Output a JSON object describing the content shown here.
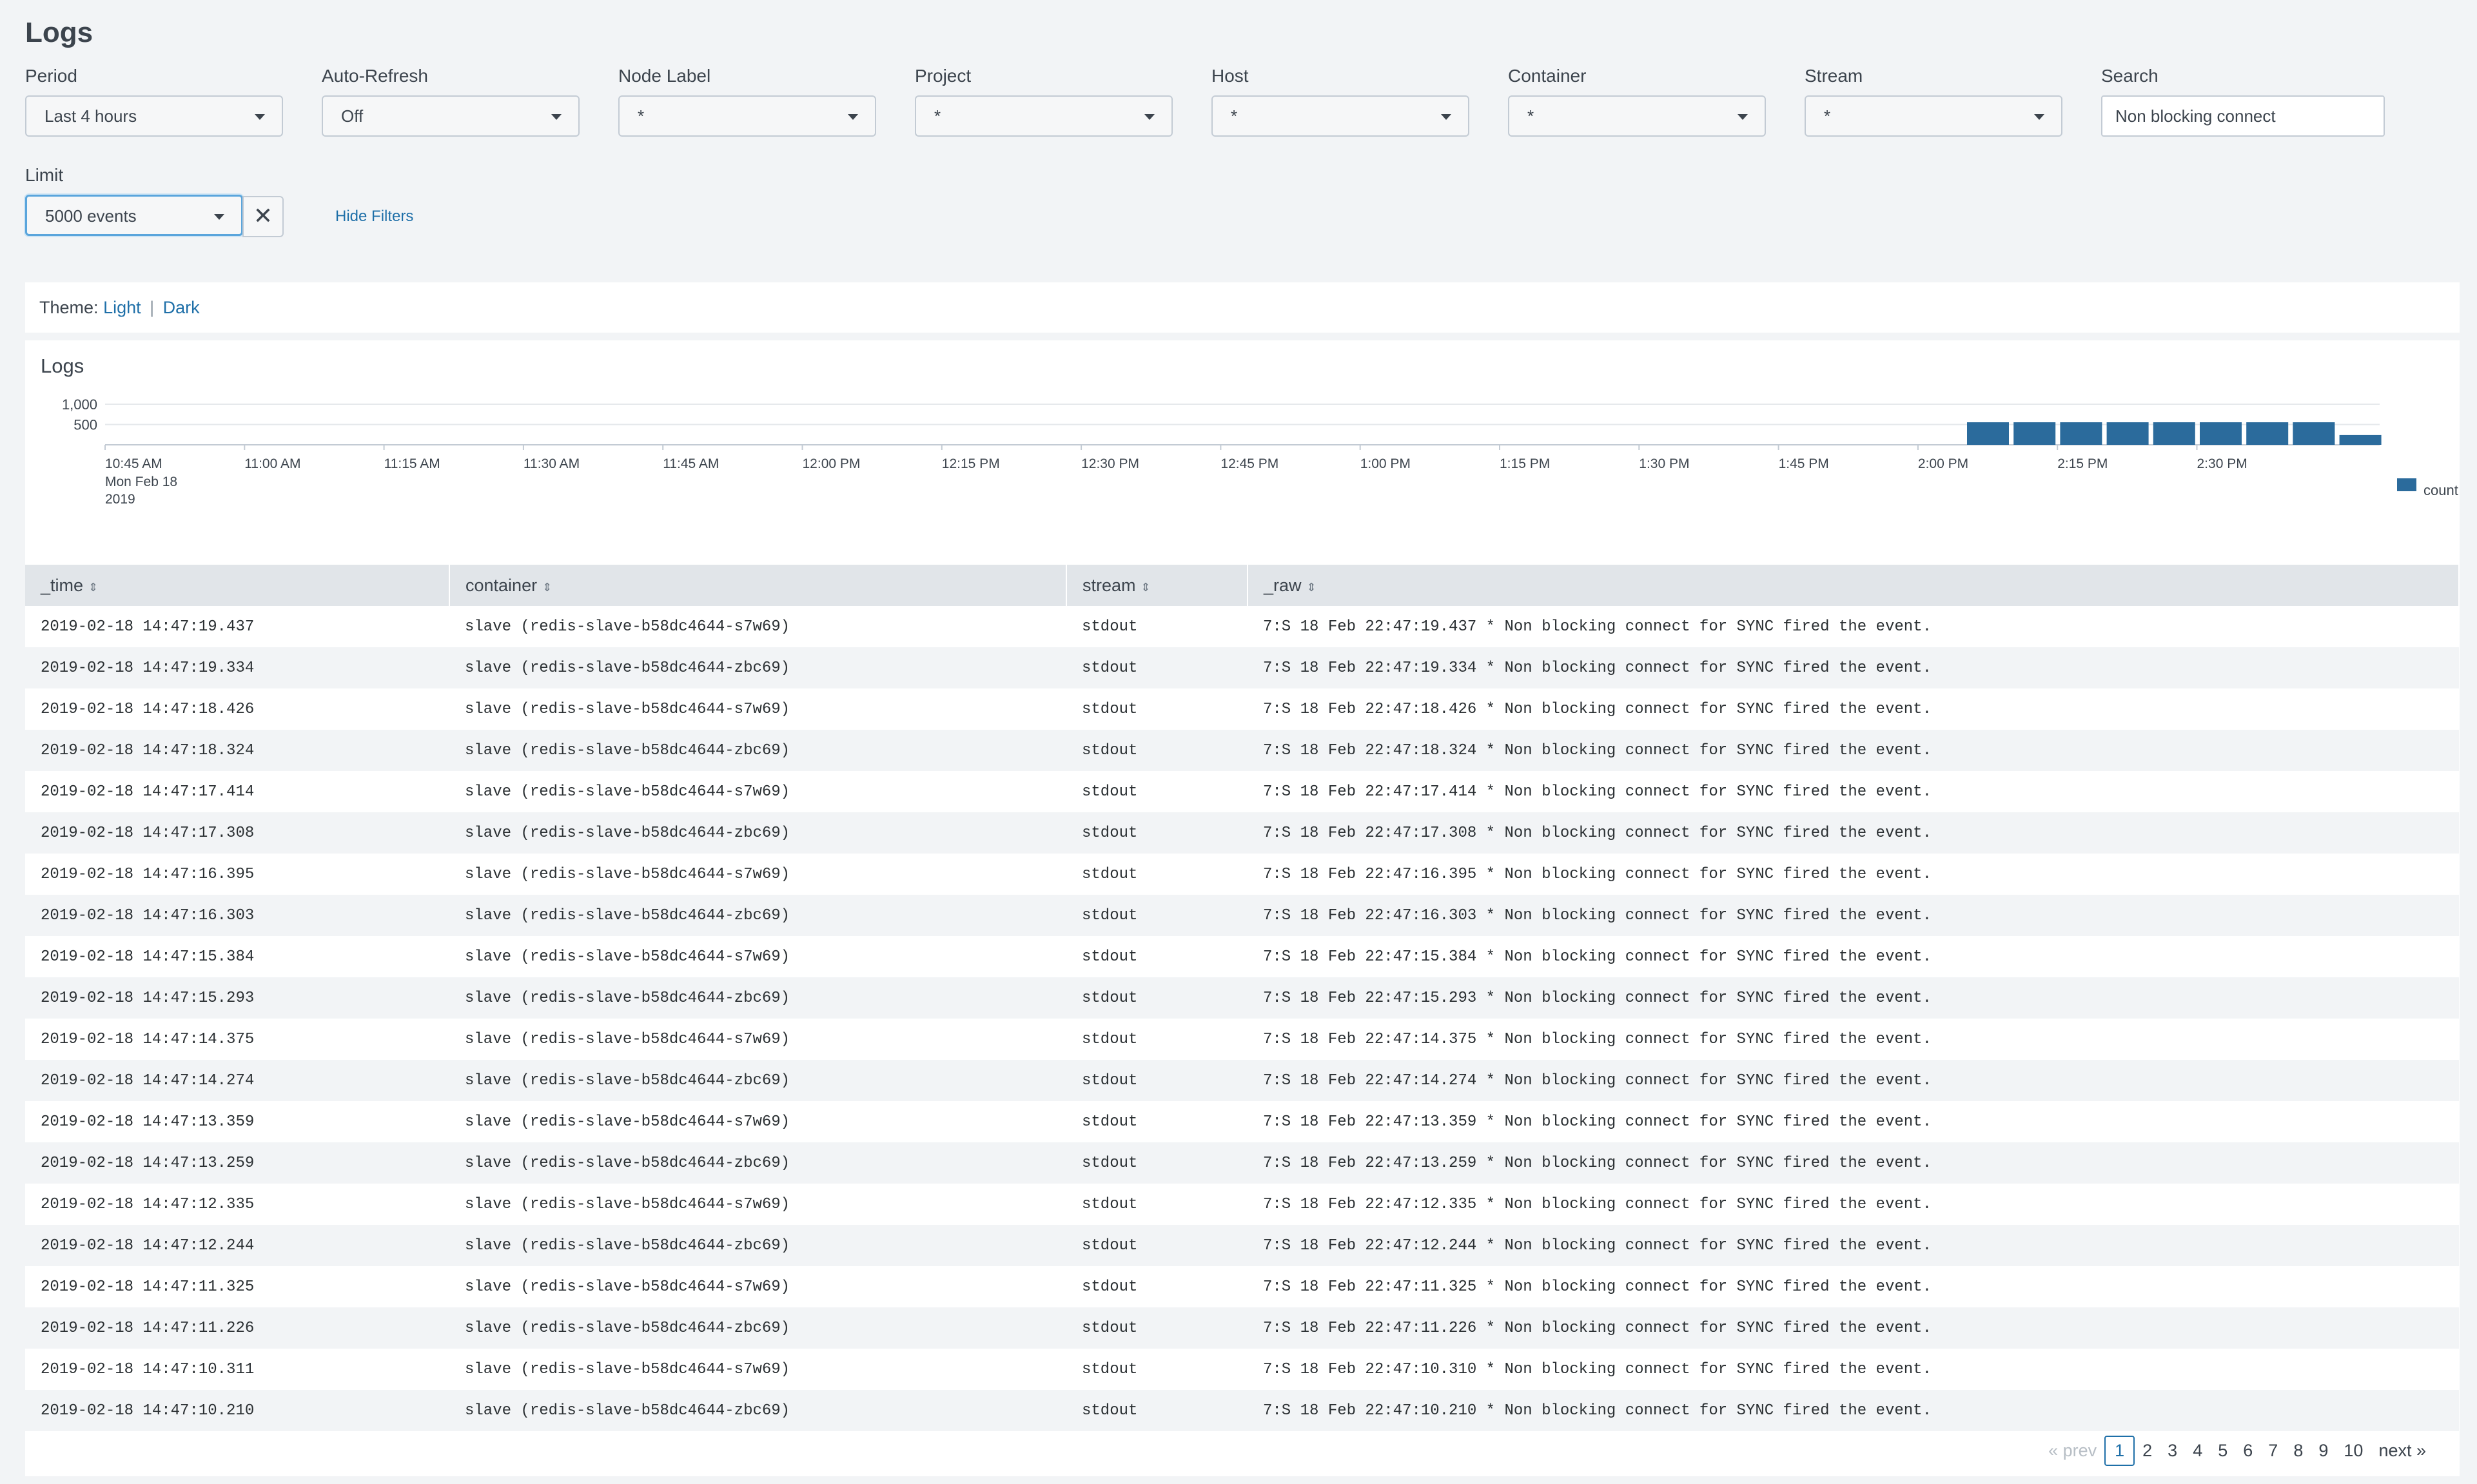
{
  "page": {
    "title": "Logs"
  },
  "filters": {
    "period": {
      "label": "Period",
      "value": "Last 4 hours"
    },
    "auto_refresh": {
      "label": "Auto-Refresh",
      "value": "Off"
    },
    "node_label": {
      "label": "Node Label",
      "value": "*"
    },
    "project": {
      "label": "Project",
      "value": "*"
    },
    "host": {
      "label": "Host",
      "value": "*"
    },
    "container": {
      "label": "Container",
      "value": "*"
    },
    "stream": {
      "label": "Stream",
      "value": "*"
    },
    "search": {
      "label": "Search",
      "value": "Non blocking connect"
    },
    "limit": {
      "label": "Limit",
      "value": "5000 events"
    },
    "clear_glyph": "✕",
    "hide_filters": "Hide Filters"
  },
  "theme": {
    "label": "Theme:",
    "light": "Light",
    "separator": "|",
    "dark": "Dark"
  },
  "logs_panel": {
    "title": "Logs"
  },
  "chart_data": {
    "type": "bar",
    "title": "",
    "xlabel": "",
    "ylabel": "",
    "y_ticks": [
      "1,000",
      "500"
    ],
    "ylim": [
      0,
      1000
    ],
    "x_ticks": [
      "10:45 AM",
      "11:00 AM",
      "11:15 AM",
      "11:30 AM",
      "11:45 AM",
      "12:00 PM",
      "12:15 PM",
      "12:30 PM",
      "12:45 PM",
      "1:00 PM",
      "1:15 PM",
      "1:30 PM",
      "1:45 PM",
      "2:00 PM",
      "2:15 PM",
      "2:30 PM"
    ],
    "x_first_sub": [
      "Mon Feb 18",
      "2019"
    ],
    "categories": [
      "2:05 PM",
      "2:10 PM",
      "2:15 PM",
      "2:20 PM",
      "2:25 PM",
      "2:30 PM",
      "2:35 PM",
      "2:40 PM",
      "2:45 PM"
    ],
    "series": [
      {
        "name": "count",
        "values": [
          555,
          555,
          555,
          555,
          555,
          555,
          555,
          555,
          240
        ],
        "color": "#2b6b9c"
      }
    ],
    "legend_position": "right"
  },
  "table": {
    "columns": [
      "_time",
      "container",
      "stream",
      "_raw"
    ],
    "rows": [
      [
        "2019-02-18 14:47:19.437",
        "slave (redis-slave-b58dc4644-s7w69)",
        "stdout",
        "7:S 18 Feb 22:47:19.437 * Non blocking connect for SYNC fired the event."
      ],
      [
        "2019-02-18 14:47:19.334",
        "slave (redis-slave-b58dc4644-zbc69)",
        "stdout",
        "7:S 18 Feb 22:47:19.334 * Non blocking connect for SYNC fired the event."
      ],
      [
        "2019-02-18 14:47:18.426",
        "slave (redis-slave-b58dc4644-s7w69)",
        "stdout",
        "7:S 18 Feb 22:47:18.426 * Non blocking connect for SYNC fired the event."
      ],
      [
        "2019-02-18 14:47:18.324",
        "slave (redis-slave-b58dc4644-zbc69)",
        "stdout",
        "7:S 18 Feb 22:47:18.324 * Non blocking connect for SYNC fired the event."
      ],
      [
        "2019-02-18 14:47:17.414",
        "slave (redis-slave-b58dc4644-s7w69)",
        "stdout",
        "7:S 18 Feb 22:47:17.414 * Non blocking connect for SYNC fired the event."
      ],
      [
        "2019-02-18 14:47:17.308",
        "slave (redis-slave-b58dc4644-zbc69)",
        "stdout",
        "7:S 18 Feb 22:47:17.308 * Non blocking connect for SYNC fired the event."
      ],
      [
        "2019-02-18 14:47:16.395",
        "slave (redis-slave-b58dc4644-s7w69)",
        "stdout",
        "7:S 18 Feb 22:47:16.395 * Non blocking connect for SYNC fired the event."
      ],
      [
        "2019-02-18 14:47:16.303",
        "slave (redis-slave-b58dc4644-zbc69)",
        "stdout",
        "7:S 18 Feb 22:47:16.303 * Non blocking connect for SYNC fired the event."
      ],
      [
        "2019-02-18 14:47:15.384",
        "slave (redis-slave-b58dc4644-s7w69)",
        "stdout",
        "7:S 18 Feb 22:47:15.384 * Non blocking connect for SYNC fired the event."
      ],
      [
        "2019-02-18 14:47:15.293",
        "slave (redis-slave-b58dc4644-zbc69)",
        "stdout",
        "7:S 18 Feb 22:47:15.293 * Non blocking connect for SYNC fired the event."
      ],
      [
        "2019-02-18 14:47:14.375",
        "slave (redis-slave-b58dc4644-s7w69)",
        "stdout",
        "7:S 18 Feb 22:47:14.375 * Non blocking connect for SYNC fired the event."
      ],
      [
        "2019-02-18 14:47:14.274",
        "slave (redis-slave-b58dc4644-zbc69)",
        "stdout",
        "7:S 18 Feb 22:47:14.274 * Non blocking connect for SYNC fired the event."
      ],
      [
        "2019-02-18 14:47:13.359",
        "slave (redis-slave-b58dc4644-s7w69)",
        "stdout",
        "7:S 18 Feb 22:47:13.359 * Non blocking connect for SYNC fired the event."
      ],
      [
        "2019-02-18 14:47:13.259",
        "slave (redis-slave-b58dc4644-zbc69)",
        "stdout",
        "7:S 18 Feb 22:47:13.259 * Non blocking connect for SYNC fired the event."
      ],
      [
        "2019-02-18 14:47:12.335",
        "slave (redis-slave-b58dc4644-s7w69)",
        "stdout",
        "7:S 18 Feb 22:47:12.335 * Non blocking connect for SYNC fired the event."
      ],
      [
        "2019-02-18 14:47:12.244",
        "slave (redis-slave-b58dc4644-zbc69)",
        "stdout",
        "7:S 18 Feb 22:47:12.244 * Non blocking connect for SYNC fired the event."
      ],
      [
        "2019-02-18 14:47:11.325",
        "slave (redis-slave-b58dc4644-s7w69)",
        "stdout",
        "7:S 18 Feb 22:47:11.325 * Non blocking connect for SYNC fired the event."
      ],
      [
        "2019-02-18 14:47:11.226",
        "slave (redis-slave-b58dc4644-zbc69)",
        "stdout",
        "7:S 18 Feb 22:47:11.226 * Non blocking connect for SYNC fired the event."
      ],
      [
        "2019-02-18 14:47:10.311",
        "slave (redis-slave-b58dc4644-s7w69)",
        "stdout",
        "7:S 18 Feb 22:47:10.310 * Non blocking connect for SYNC fired the event."
      ],
      [
        "2019-02-18 14:47:10.210",
        "slave (redis-slave-b58dc4644-zbc69)",
        "stdout",
        "7:S 18 Feb 22:47:10.210 * Non blocking connect for SYNC fired the event."
      ]
    ]
  },
  "pagination": {
    "prev": "« prev",
    "pages": [
      "1",
      "2",
      "3",
      "4",
      "5",
      "6",
      "7",
      "8",
      "9",
      "10"
    ],
    "current": "1",
    "next": "next »"
  },
  "colors": {
    "accent": "#1e6fa8",
    "bar": "#2b6b9c",
    "header_bg": "#e1e5e9"
  }
}
